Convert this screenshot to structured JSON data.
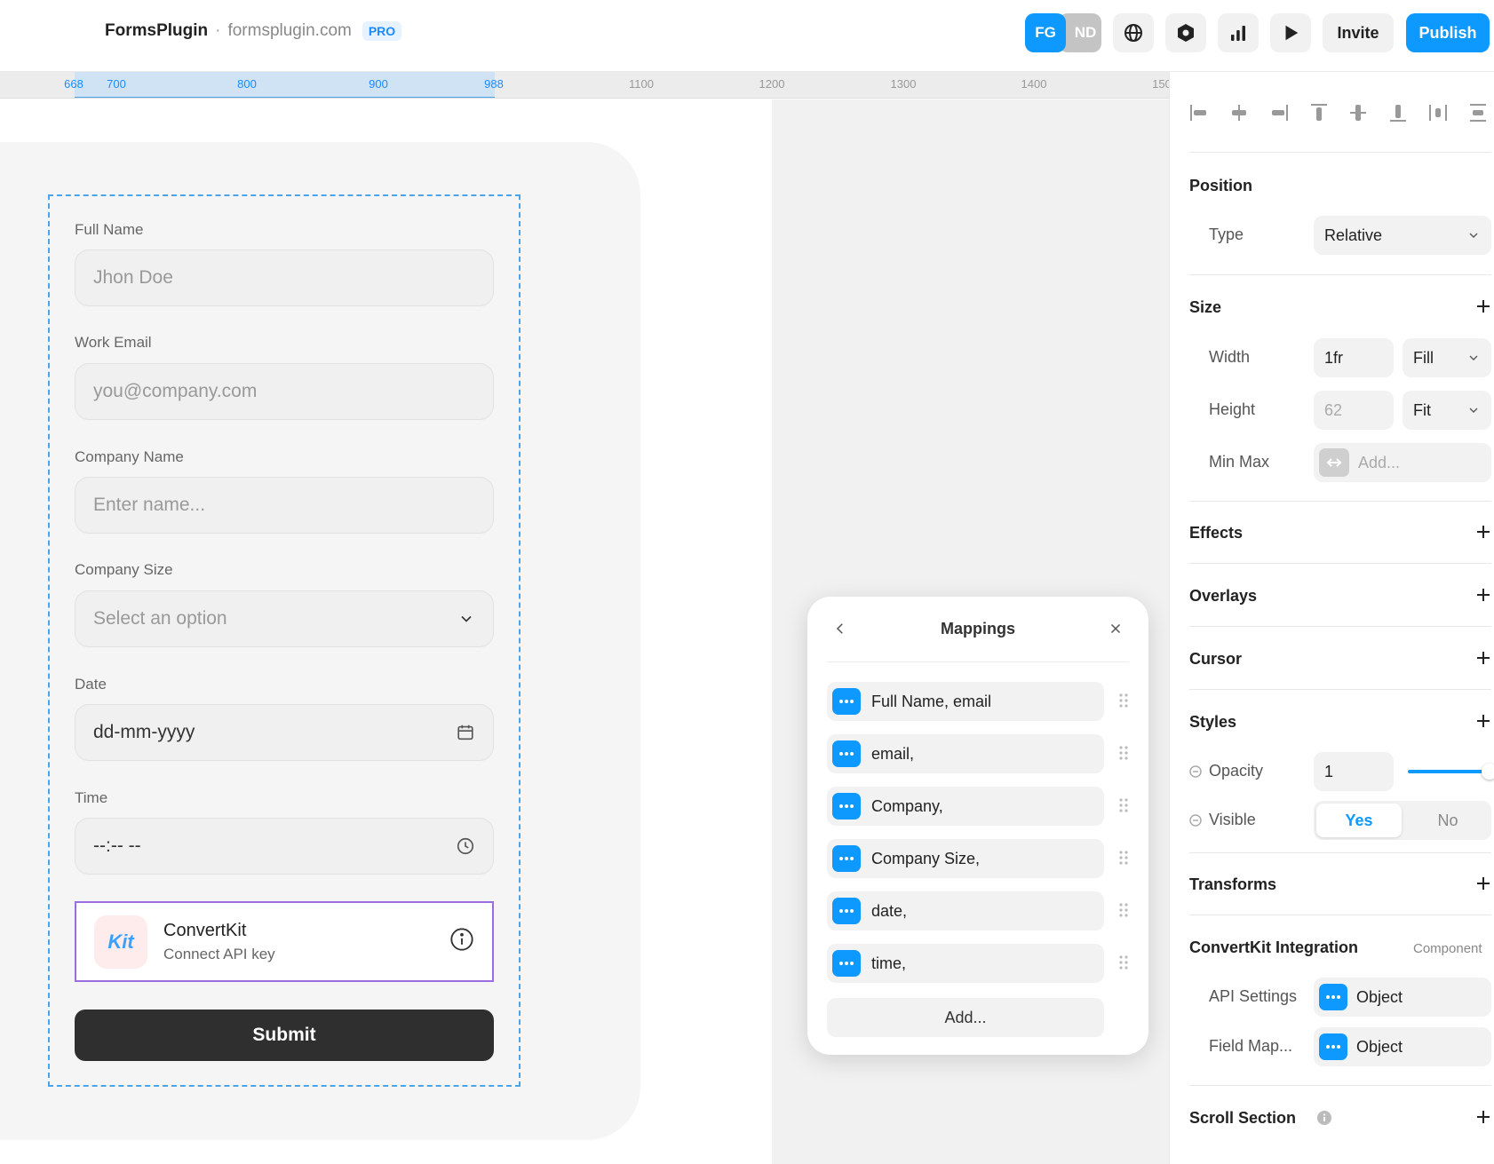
{
  "topbar": {
    "brand_name": "FormsPlugin",
    "separator": "·",
    "domain": "formsplugin.com",
    "badge": "PRO",
    "avatars": [
      "FG",
      "ND"
    ],
    "invite_label": "Invite",
    "publish_label": "Publish",
    "icons": [
      "globe-icon",
      "settings-hexagon-icon",
      "analytics-icon",
      "play-icon"
    ]
  },
  "ruler": {
    "selected_ticks": [
      "668",
      "700",
      "800",
      "900",
      "988"
    ],
    "ticks": [
      "1100",
      "1200",
      "1300",
      "1400",
      "150"
    ]
  },
  "form": {
    "fields": [
      {
        "label": "Full Name",
        "placeholder": "Jhon Doe"
      },
      {
        "label": "Work Email",
        "placeholder": "you@company.com"
      },
      {
        "label": "Company Name",
        "placeholder": "Enter name..."
      },
      {
        "label": "Company Size",
        "placeholder": "Select an option"
      },
      {
        "label": "Date",
        "value": "dd-mm-yyyy"
      },
      {
        "label": "Time",
        "value": "--:-- --"
      }
    ],
    "convertkit": {
      "logo": "Kit",
      "title": "ConvertKit",
      "subtitle": "Connect API key"
    },
    "submit_label": "Submit"
  },
  "mappings": {
    "title": "Mappings",
    "items": [
      "Full Name, email",
      "email,",
      "Company,",
      "Company Size,",
      "date,",
      "time,"
    ],
    "add_label": "Add..."
  },
  "panel": {
    "position": {
      "title": "Position",
      "type_label": "Type",
      "type_value": "Relative"
    },
    "size": {
      "title": "Size",
      "width_label": "Width",
      "width_value": "1fr",
      "width_mode": "Fill",
      "height_label": "Height",
      "height_value": "62",
      "height_mode": "Fit",
      "minmax_label": "Min Max",
      "minmax_placeholder": "Add..."
    },
    "effects_title": "Effects",
    "overlays_title": "Overlays",
    "cursor_title": "Cursor",
    "styles": {
      "title": "Styles",
      "opacity_label": "Opacity",
      "opacity_value": "1",
      "opacity_level": 1.0,
      "visible_label": "Visible",
      "visible_yes": "Yes",
      "visible_no": "No"
    },
    "transforms_title": "Transforms",
    "convertkit": {
      "title": "ConvertKit Integration",
      "tag": "Component",
      "api_label": "API Settings",
      "api_value": "Object",
      "fieldmap_label": "Field Map...",
      "fieldmap_value": "Object"
    },
    "scroll_title": "Scroll Section"
  },
  "colors": {
    "accent": "#0d99ff",
    "selection": "#4aa4ea",
    "convertkit_border": "#9a6ee0",
    "submit_bg": "#2f2f2f"
  }
}
